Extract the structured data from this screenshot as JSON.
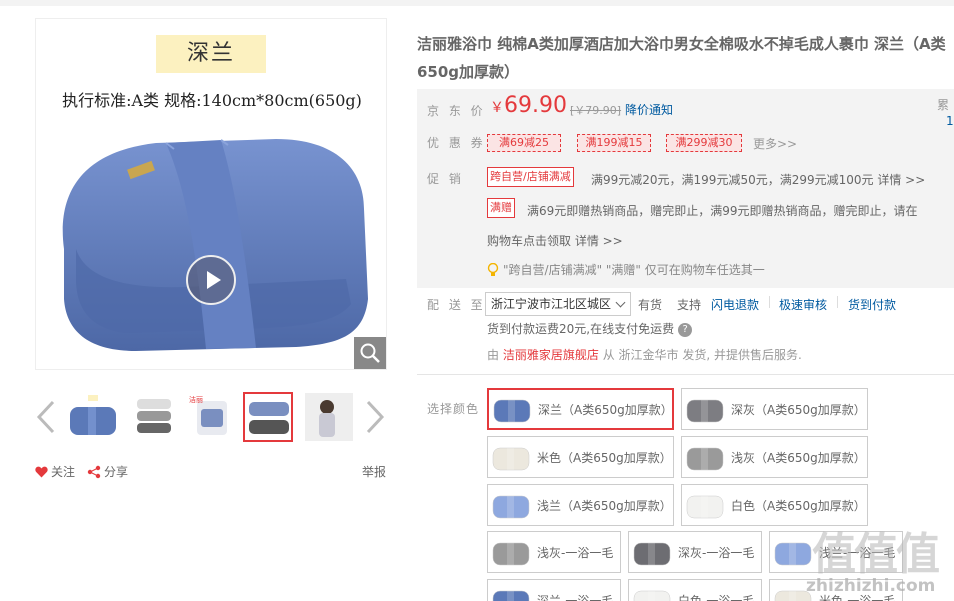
{
  "product": {
    "image_label": "深兰",
    "image_spec": "执行标准:A类  规格:140cm*80cm(650g)",
    "title": "洁丽雅浴巾 纯棉A类加厚酒店加大浴巾男女全棉吸水不掉毛成人裹巾 深兰（A类650g加厚款）"
  },
  "gallery": {
    "thumb_count": 5,
    "active_thumb": 4,
    "follow_label": "关注",
    "share_label": "分享",
    "report_label": "举报"
  },
  "price": {
    "label": "京 东 价",
    "currency": "￥",
    "value": "69.90",
    "old_price": "[￥79.90]",
    "notice": "降价通知",
    "side_label": "累",
    "side_value": "1"
  },
  "coupons": {
    "label": "优 惠 券",
    "items": [
      "满69减25",
      "满199减15",
      "满299减30"
    ],
    "more": "更多>>"
  },
  "promo": {
    "label": "促    销",
    "tag1": "跨自营/店铺满减",
    "text1": "满99元减20元，满199元减50元，满299元减100元 详情 >>",
    "tag2": "满赠",
    "text2a": "满69元即赠热销商品，赠完即止，满99元即赠热销商品，赠完即止，请在",
    "text2b": "购物车点击领取 详情 >>",
    "tip": "\"跨自营/店铺满减\" \"满赠\" 仅可在购物车任选其一"
  },
  "delivery": {
    "label": "配 送 至",
    "address": "浙江宁波市江北区城区",
    "stock": "有货",
    "support": "支持",
    "services": [
      "闪电退款",
      "极速审核",
      "货到付款"
    ],
    "cod_note": "货到付款运费20元,在线支付免运费",
    "by_prefix": "由",
    "store": "洁丽雅家居旗舰店",
    "by_suffix": "从 浙江金华市 发货, 并提供售后服务."
  },
  "colors": {
    "label": "选择颜色",
    "options": [
      {
        "text": "深兰（A类650g加厚款）",
        "swatch": "#5b79b8"
      },
      {
        "text": "深灰（A类650g加厚款）",
        "swatch": "#7d7d82"
      },
      {
        "text": "米色（A类650g加厚款）",
        "swatch": "#ece8de"
      },
      {
        "text": "浅灰（A类650g加厚款）",
        "swatch": "#9a9a9a"
      },
      {
        "text": "浅兰（A类650g加厚款）",
        "swatch": "#8ea8df"
      },
      {
        "text": "白色（A类650g加厚款）",
        "swatch": "#f2f2f0"
      },
      {
        "text": "浅灰-一浴一毛",
        "swatch": "#9a9a9a"
      },
      {
        "text": "深灰-一浴一毛",
        "swatch": "#6d6d72"
      },
      {
        "text": "浅兰-一浴一毛",
        "swatch": "#8ea8df"
      },
      {
        "text": "深兰-一浴一毛",
        "swatch": "#5b79b8"
      },
      {
        "text": "白色-一浴一毛",
        "swatch": "#f2f2f0"
      },
      {
        "text": "米色-一浴一毛",
        "swatch": "#ece8de"
      }
    ]
  },
  "watermark": {
    "logo": "值值值",
    "url": "zhizhizhi.com"
  },
  "accent": "#e4393c",
  "link_color": "#005aa0"
}
